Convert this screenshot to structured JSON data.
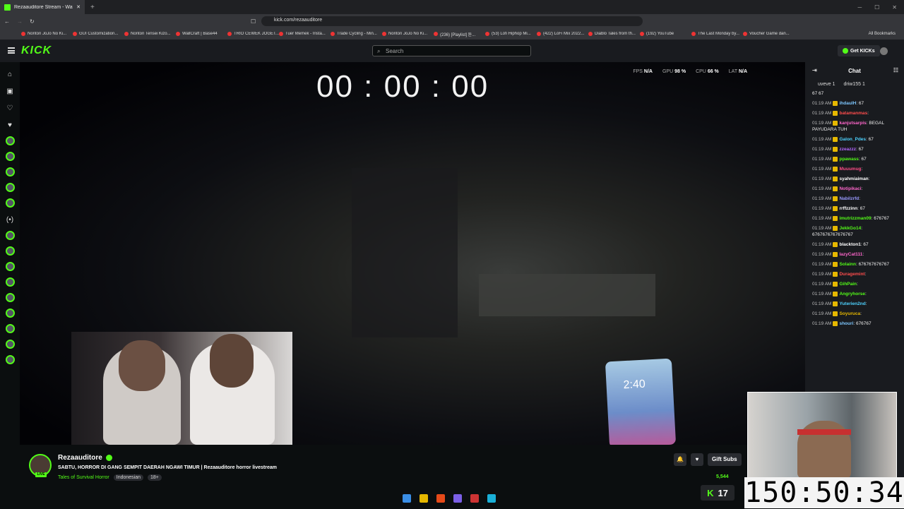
{
  "browser": {
    "tab_title": "Rezaauditore Stream - Watch",
    "url": "kick.com/rezaauditore",
    "bookmarks": [
      "Nonton JoJo No Ki...",
      "GUI Customization...",
      "Nonton Tensei Kizo...",
      "WallCraft | Base44",
      "TRIO CEWEK JOGET...",
      "Tuer Memek - Insta...",
      "Trade Cycling - Min...",
      "Nonton JoJo No Ki...",
      "(236) [Playlist] 듣...",
      "(53) Lofi Hiphop Mi...",
      "(422) LoFi Mix 2022...",
      "Diablo Tales from th...",
      "(192) YouTube",
      "The Last Monday by...",
      "Voucher Game dan..."
    ],
    "all_bookmarks": "All Bookmarks"
  },
  "header": {
    "logo": "KICK",
    "search_placeholder": "Search",
    "get_kicks": "Get KICKs"
  },
  "player": {
    "timer": "00 : 00 : 00",
    "stats": {
      "fps_label": "FPS",
      "fps": "N/A",
      "gpu_label": "GPU",
      "gpu": "98 %",
      "cpu_label": "CPU",
      "cpu": "66 %",
      "lat_label": "LAT",
      "lat": "N/A"
    },
    "phone_time": "2:40"
  },
  "chat": {
    "title": "Chat",
    "gifters": [
      "uveve 1",
      "driw155 1"
    ],
    "first_line": "67 67",
    "messages": [
      {
        "time": "01:19 AM",
        "user": "ihdaulH",
        "color": "#7ec8ff",
        "text": ": 67"
      },
      {
        "time": "01:19 AM",
        "user": "batamanmas",
        "color": "#ff4d4d",
        "text": ":"
      },
      {
        "time": "01:19 AM",
        "user": "kanjutsarpis",
        "color": "#ff66cc",
        "text": ": BEGAL PAYUDARA TUH"
      },
      {
        "time": "01:19 AM",
        "user": "Galon_Pdes",
        "color": "#4dd2ff",
        "text": ": 67"
      },
      {
        "time": "01:19 AM",
        "user": "zzeazzz",
        "color": "#b366ff",
        "text": ": 67"
      },
      {
        "time": "01:19 AM",
        "user": "ppawass",
        "color": "#53fc18",
        "text": ": 67"
      },
      {
        "time": "01:19 AM",
        "user": "Muuumug",
        "color": "#ff4d88",
        "text": ":"
      },
      {
        "time": "01:19 AM",
        "user": "syahmiaiman",
        "color": "#ffffff",
        "text": ":"
      },
      {
        "time": "01:19 AM",
        "user": "Notipikaci",
        "color": "#ff66cc",
        "text": ":"
      },
      {
        "time": "01:19 AM",
        "user": "Nabilzrfd",
        "color": "#9999ff",
        "text": ":"
      },
      {
        "time": "01:19 AM",
        "user": "rrffzzinn",
        "color": "#ffffff",
        "text": ": 67"
      },
      {
        "time": "01:19 AM",
        "user": "imutrizzman09",
        "color": "#53fc18",
        "text": ": 676767"
      },
      {
        "time": "01:19 AM",
        "user": "JekkGo14",
        "color": "#53fc18",
        "text": ": 6767676767676767"
      },
      {
        "time": "01:19 AM",
        "user": "blackton1",
        "color": "#ffffff",
        "text": ": 67"
      },
      {
        "time": "01:19 AM",
        "user": "lazyCat111",
        "color": "#ff66cc",
        "text": ":"
      },
      {
        "time": "01:19 AM",
        "user": "Solainn",
        "color": "#53fc18",
        "text": ": 676767676767"
      },
      {
        "time": "01:19 AM",
        "user": "Duragemint",
        "color": "#ff4d4d",
        "text": ":"
      },
      {
        "time": "01:19 AM",
        "user": "GihPain",
        "color": "#53fc18",
        "text": ":"
      },
      {
        "time": "01:19 AM",
        "user": "Angryhorse",
        "color": "#53fc18",
        "text": ":"
      },
      {
        "time": "01:19 AM",
        "user": "Yuterien2nd",
        "color": "#4dd2ff",
        "text": ":"
      },
      {
        "time": "01:19 AM",
        "user": "Soyuruca",
        "color": "#e6b800",
        "text": ":"
      },
      {
        "time": "01:19 AM",
        "user": "shouri",
        "color": "#7ec8ff",
        "text": ": 676767"
      }
    ]
  },
  "channel": {
    "name": "Rezaauditore",
    "live_badge": "LIVE",
    "stream_title": "SABTU, HORROR DI GANG SEMPIT DAERAH NGAWI TIMUR | Rezaauditore horror livestream",
    "category": "Tales of Survival Horror",
    "tags": [
      "Indonesian",
      "18+"
    ],
    "gift_subs": "Gift Subs",
    "viewers": "5,544"
  },
  "overlay": {
    "kick_count": "17",
    "big_clock": "150:50:34"
  }
}
